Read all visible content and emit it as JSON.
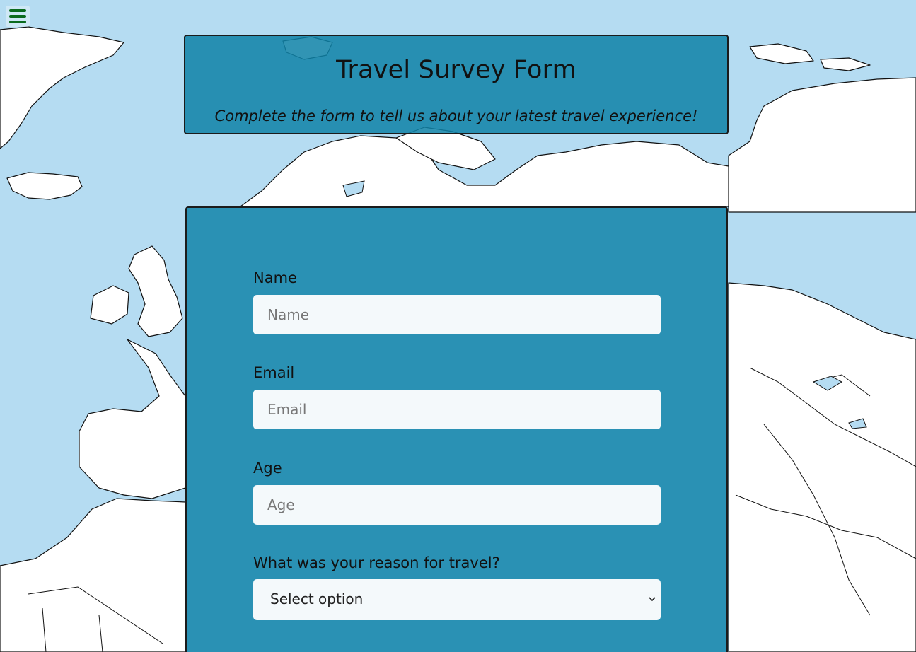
{
  "header": {
    "title": "Travel Survey Form",
    "subtitle": "Complete the form to tell us about your latest travel experience!"
  },
  "menu": {
    "icon": "hamburger-menu-icon",
    "color": "#0b6b1e"
  },
  "form": {
    "name": {
      "label": "Name",
      "placeholder": "Name",
      "value": ""
    },
    "email": {
      "label": "Email",
      "placeholder": "Email",
      "value": ""
    },
    "age": {
      "label": "Age",
      "placeholder": "Age",
      "value": ""
    },
    "reason": {
      "label": "What was your reason for travel?",
      "selected": "Select option",
      "icon": "chevron-down-icon"
    }
  },
  "colors": {
    "ocean": "#b5dcf2",
    "land": "#ffffff",
    "card": "#0f82a8",
    "accent": "#0b6b1e"
  }
}
